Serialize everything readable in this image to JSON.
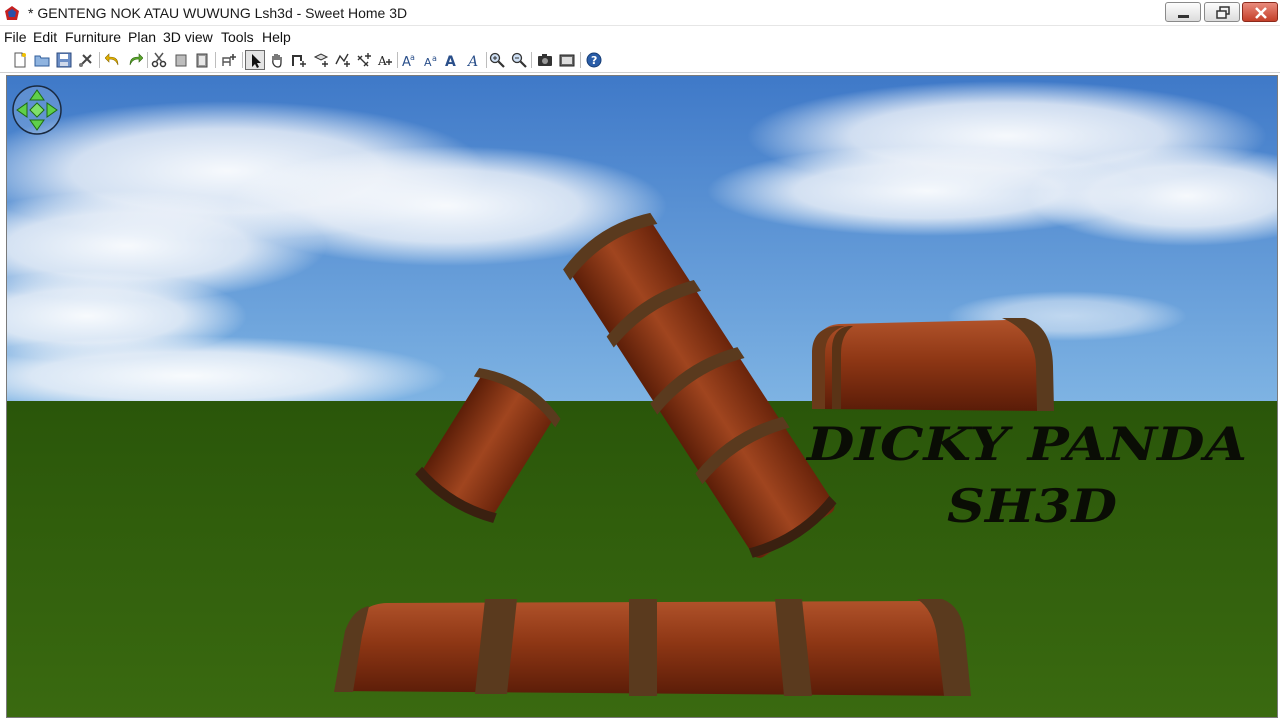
{
  "window": {
    "title": "* GENTENG NOK ATAU WUWUNG Lsh3d - Sweet Home 3D",
    "app_icon": "sweet-home-3d-icon",
    "controls": [
      "minimize-icon",
      "restore-icon",
      "close-icon"
    ]
  },
  "menubar": {
    "items": [
      {
        "label": "File"
      },
      {
        "label": "Edit"
      },
      {
        "label": "Furniture"
      },
      {
        "label": "Plan"
      },
      {
        "label": "3D view"
      },
      {
        "label": "Tools"
      },
      {
        "label": "Help"
      }
    ]
  },
  "toolbar": {
    "tools": [
      {
        "icon": "new-icon"
      },
      {
        "icon": "open-icon"
      },
      {
        "icon": "save-icon"
      },
      {
        "icon": "preferences-icon"
      },
      {
        "icon": "undo-icon"
      },
      {
        "icon": "redo-icon"
      },
      {
        "icon": "cut-icon"
      },
      {
        "icon": "copy-icon"
      },
      {
        "icon": "paste-icon"
      },
      {
        "icon": "add-furniture-icon"
      },
      {
        "icon": "select-arrow-icon",
        "selected": true
      },
      {
        "icon": "pan-hand-icon"
      },
      {
        "icon": "create-walls-icon"
      },
      {
        "icon": "create-rooms-icon"
      },
      {
        "icon": "create-polylines-icon"
      },
      {
        "icon": "create-dimensions-icon"
      },
      {
        "icon": "add-text-icon"
      },
      {
        "icon": "increase-text-size-icon"
      },
      {
        "icon": "decrease-text-size-icon"
      },
      {
        "icon": "bold-text-icon"
      },
      {
        "icon": "italic-text-icon"
      },
      {
        "icon": "zoom-in-icon"
      },
      {
        "icon": "zoom-out-icon"
      },
      {
        "icon": "create-photo-icon"
      },
      {
        "icon": "create-video-icon"
      },
      {
        "icon": "help-icon"
      }
    ]
  },
  "view3d": {
    "navigation_widget": "navigation-arrows-icon",
    "overlay_text": {
      "line1": "DICKY PANDA",
      "line2": "SH3D"
    },
    "colors": {
      "sky": "#6a9fd9",
      "ground": "#2f5c0c",
      "tile": "#8a3614",
      "tile_band": "#5a3a1e"
    }
  }
}
